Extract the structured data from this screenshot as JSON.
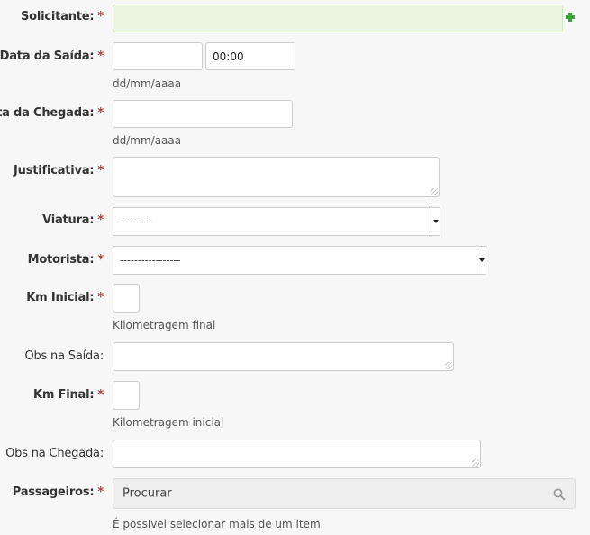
{
  "fields": {
    "solicitante": {
      "label": "Solicitante:",
      "required": "*"
    },
    "data_saida": {
      "label": "Data da Saída:",
      "required": "*",
      "time_value": "00:00",
      "help": "dd/mm/aaaa"
    },
    "data_chegada": {
      "label": "Data da Chegada:",
      "required": "*",
      "help": "dd/mm/aaaa"
    },
    "justificativa": {
      "label": "Justificativa:",
      "required": "*"
    },
    "viatura": {
      "label": "Viatura:",
      "required": "*",
      "selected": "---------"
    },
    "motorista": {
      "label": "Motorista:",
      "required": "*",
      "selected": "-----------------"
    },
    "km_inicial": {
      "label": "Km Inicial:",
      "required": "*",
      "help": "Kilometragem final"
    },
    "obs_saida": {
      "label": "Obs na Saída:"
    },
    "km_final": {
      "label": "Km Final:",
      "required": "*",
      "help": "Kilometragem inicial"
    },
    "obs_chegada": {
      "label": "Obs na Chegada:"
    },
    "passageiros": {
      "label": "Passageiros:",
      "required": "*",
      "placeholder": "Procurar",
      "help": "É possível selecionar mais de um item"
    }
  },
  "icons": {
    "add": "plus-icon",
    "search": "search-icon"
  },
  "colors": {
    "required": "#c0392b",
    "add_icon": "#3aa33a",
    "autocomplete_bg": "#e9f7e1"
  }
}
